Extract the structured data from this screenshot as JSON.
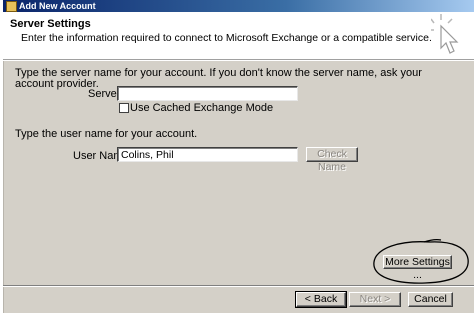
{
  "window": {
    "title": "Add New Account"
  },
  "header": {
    "title": "Server Settings",
    "subtitle": "Enter the information required to connect to Microsoft Exchange or a compatible service."
  },
  "server_section": {
    "instructions_line1": "Type the server name for your account. If you don't know the server name, ask your",
    "instructions_line2": "account provider.",
    "server_label": "Server:",
    "server_value": "",
    "cached_mode_label": "Use Cached Exchange Mode",
    "cached_mode_checked": false
  },
  "user_section": {
    "instructions": "Type the user name for your account.",
    "user_label": "User Name:",
    "user_value": "Colins, Phil",
    "check_name_label": "Check Name"
  },
  "more_settings_label": "More Settings ...",
  "footer": {
    "back_label": "< Back",
    "next_label": "Next >",
    "cancel_label": "Cancel"
  }
}
